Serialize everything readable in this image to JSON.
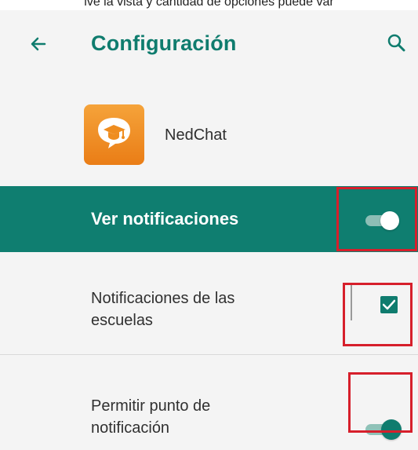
{
  "top_caption": "ive la vista y cantidad de opciones puede var",
  "header": {
    "title": "Configuración",
    "back_icon": "arrow-back-icon",
    "search_icon": "search-icon"
  },
  "app": {
    "name": "NedChat",
    "logo_icon": "nedchat-logo-icon"
  },
  "settings": {
    "master": {
      "label": "Ver notificaciones",
      "enabled": true
    },
    "school_notifications": {
      "label_line1": "Notificaciones de las",
      "label_line2": "escuelas",
      "checked": true
    },
    "notification_dot": {
      "label_line1": "Permitir punto de",
      "label_line2": "notificación",
      "enabled": true
    }
  },
  "colors": {
    "accent": "#0f7c6e",
    "header_text": "#0f7c6e",
    "master_background": "#0f7e70",
    "highlight_border": "#d61f2b",
    "logo_orange": "#ea7d16"
  }
}
